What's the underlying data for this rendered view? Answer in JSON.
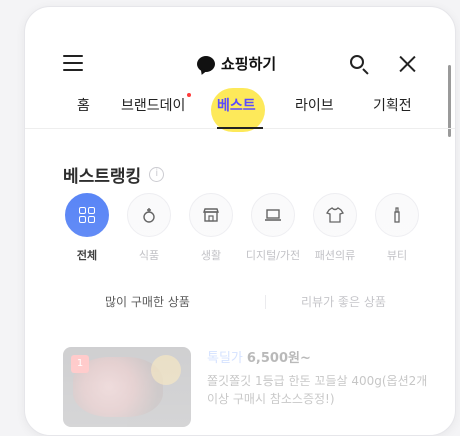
{
  "header": {
    "title": "쇼핑하기"
  },
  "tabs": [
    {
      "label": "홈",
      "has_dot": false,
      "active": false
    },
    {
      "label": "브랜드데이",
      "has_dot": true,
      "active": false
    },
    {
      "label": "베스트",
      "has_dot": false,
      "active": true
    },
    {
      "label": "라이브",
      "has_dot": false,
      "active": false
    },
    {
      "label": "기획전",
      "has_dot": false,
      "active": false
    }
  ],
  "section": {
    "title": "베스트랭킹",
    "info_icon": "i"
  },
  "categories": [
    {
      "label": "전체",
      "icon": "grid-icon",
      "active": true
    },
    {
      "label": "식품",
      "icon": "food-icon",
      "active": false
    },
    {
      "label": "생활",
      "icon": "store-icon",
      "active": false
    },
    {
      "label": "디지털/가전",
      "icon": "laptop-icon",
      "active": false
    },
    {
      "label": "패션의류",
      "icon": "shirt-icon",
      "active": false
    },
    {
      "label": "뷰티",
      "icon": "lipstick-icon",
      "active": false
    }
  ],
  "sort_tabs": [
    {
      "label": "많이 구매한 상품",
      "active": true
    },
    {
      "label": "리뷰가 좋은 상품",
      "active": false
    }
  ],
  "product": {
    "rank": "1",
    "tag": "톡딜가",
    "price": "6,500원~",
    "name": "쫄깃쫄깃 1등급 한돈 꼬들살 400g(옵션2개 이상 구매시 참소스증정!)"
  },
  "colors": {
    "accent": "#4d7cf5",
    "active_tab": "#5a4bff",
    "highlight": "#fde74c",
    "badge_dot": "#ff3b3b"
  }
}
